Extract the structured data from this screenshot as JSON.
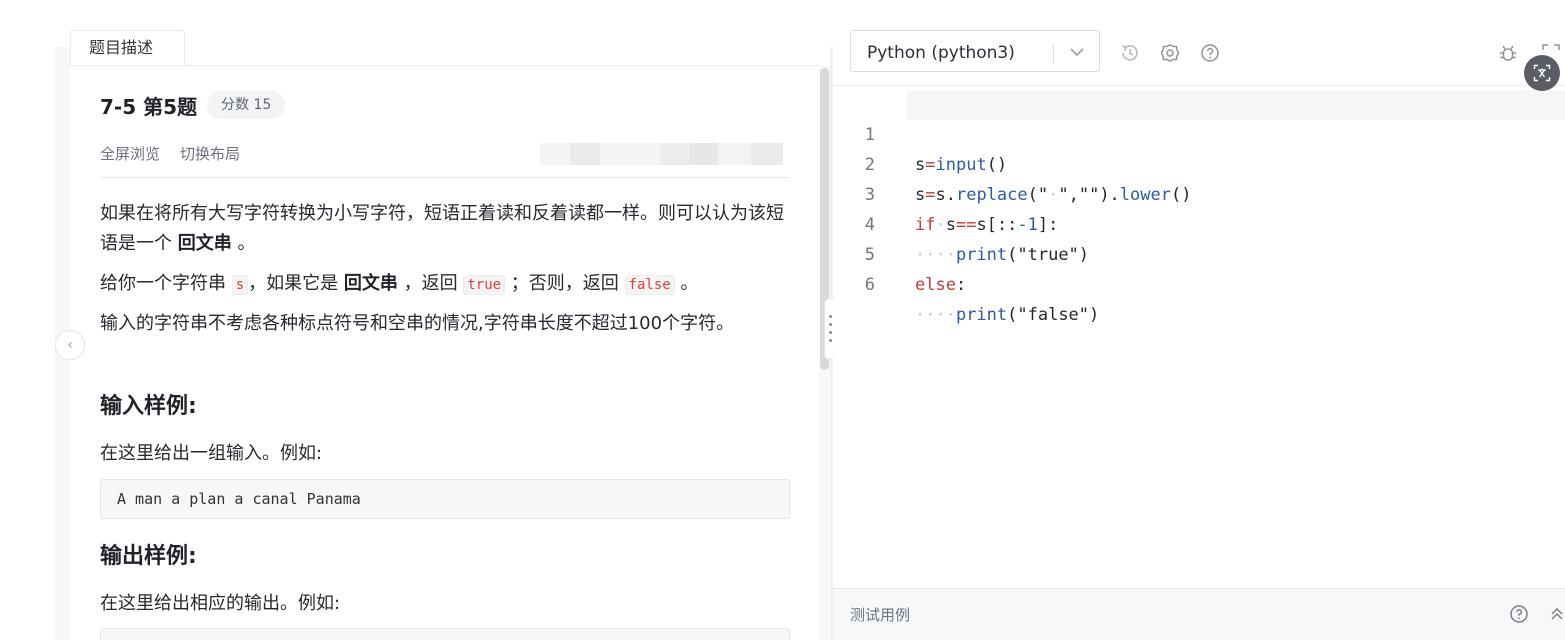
{
  "tabs": {
    "active_label": "题目描述"
  },
  "problem": {
    "title": "7-5 第5题",
    "score_label": "分数 15",
    "tools": [
      "全屏浏览",
      "切换布局"
    ],
    "para1": {
      "text_a": "如果在将所有大写字符转换为小写字符，短语正着读和反着读都一样。则可以认为该短语是一个 ",
      "bold": "回文串",
      "text_b": " 。"
    },
    "para2": {
      "text_a": "给你一个字符串 ",
      "code_s": "s",
      "text_b": "，如果它是 ",
      "bold": "回文串",
      "text_c": " ，返回 ",
      "code_true": "true",
      "text_d": " ；否则，返回 ",
      "code_false": "false",
      "text_e": " 。"
    },
    "para3": "输入的字符串不考虑各种标点符号和空串的情况,字符串长度不超过100个字符。",
    "input_heading": "输入样例:",
    "input_desc": "在这里给出一组输入。例如:",
    "input_sample": "A man a plan a canal Panama",
    "output_heading": "输出样例:",
    "output_desc": "在这里给出相应的输出。例如:"
  },
  "editor": {
    "language": "Python (python3)",
    "lines": [
      {
        "n": "1"
      },
      {
        "n": "2"
      },
      {
        "n": "3"
      },
      {
        "n": "4"
      },
      {
        "n": "5"
      },
      {
        "n": "6"
      }
    ],
    "tokens": {
      "l1_s": "s",
      "l1_eq": "=",
      "l1_fn": "input",
      "l1_p": "()",
      "l2_s": "s",
      "l2_eq": "=",
      "l2_s2": "s.",
      "l2_fn": "replace",
      "l2_a": "(\"",
      "l2_dot": "·",
      "l2_b": "\",\"\").",
      "l2_fn2": "lower",
      "l2_c": "()",
      "l3_kw": "if",
      "l3_dot": "·",
      "l3_s": "s",
      "l3_op": "==",
      "l3_b": "s[::",
      "l3_num": "-1",
      "l3_c": "]:",
      "l4_dots": "····",
      "l4_fn": "print",
      "l4_arg": "(\"true\")",
      "l5_kw": "else",
      "l5_c": ":",
      "l6_dots": "····",
      "l6_fn": "print",
      "l6_arg": "(\"false\")"
    }
  },
  "bottom_bar": {
    "label": "测试用例"
  },
  "icons": [
    "chevron-left-icon",
    "chevron-down-icon",
    "history-icon",
    "settings-icon",
    "help-icon",
    "bug-icon",
    "fullscreen-icon",
    "translate-icon",
    "chevrons-up-icon"
  ],
  "colors": {
    "keyword": "#c63a3a",
    "function": "#2f5aa8",
    "line_number": "#6e7681"
  }
}
